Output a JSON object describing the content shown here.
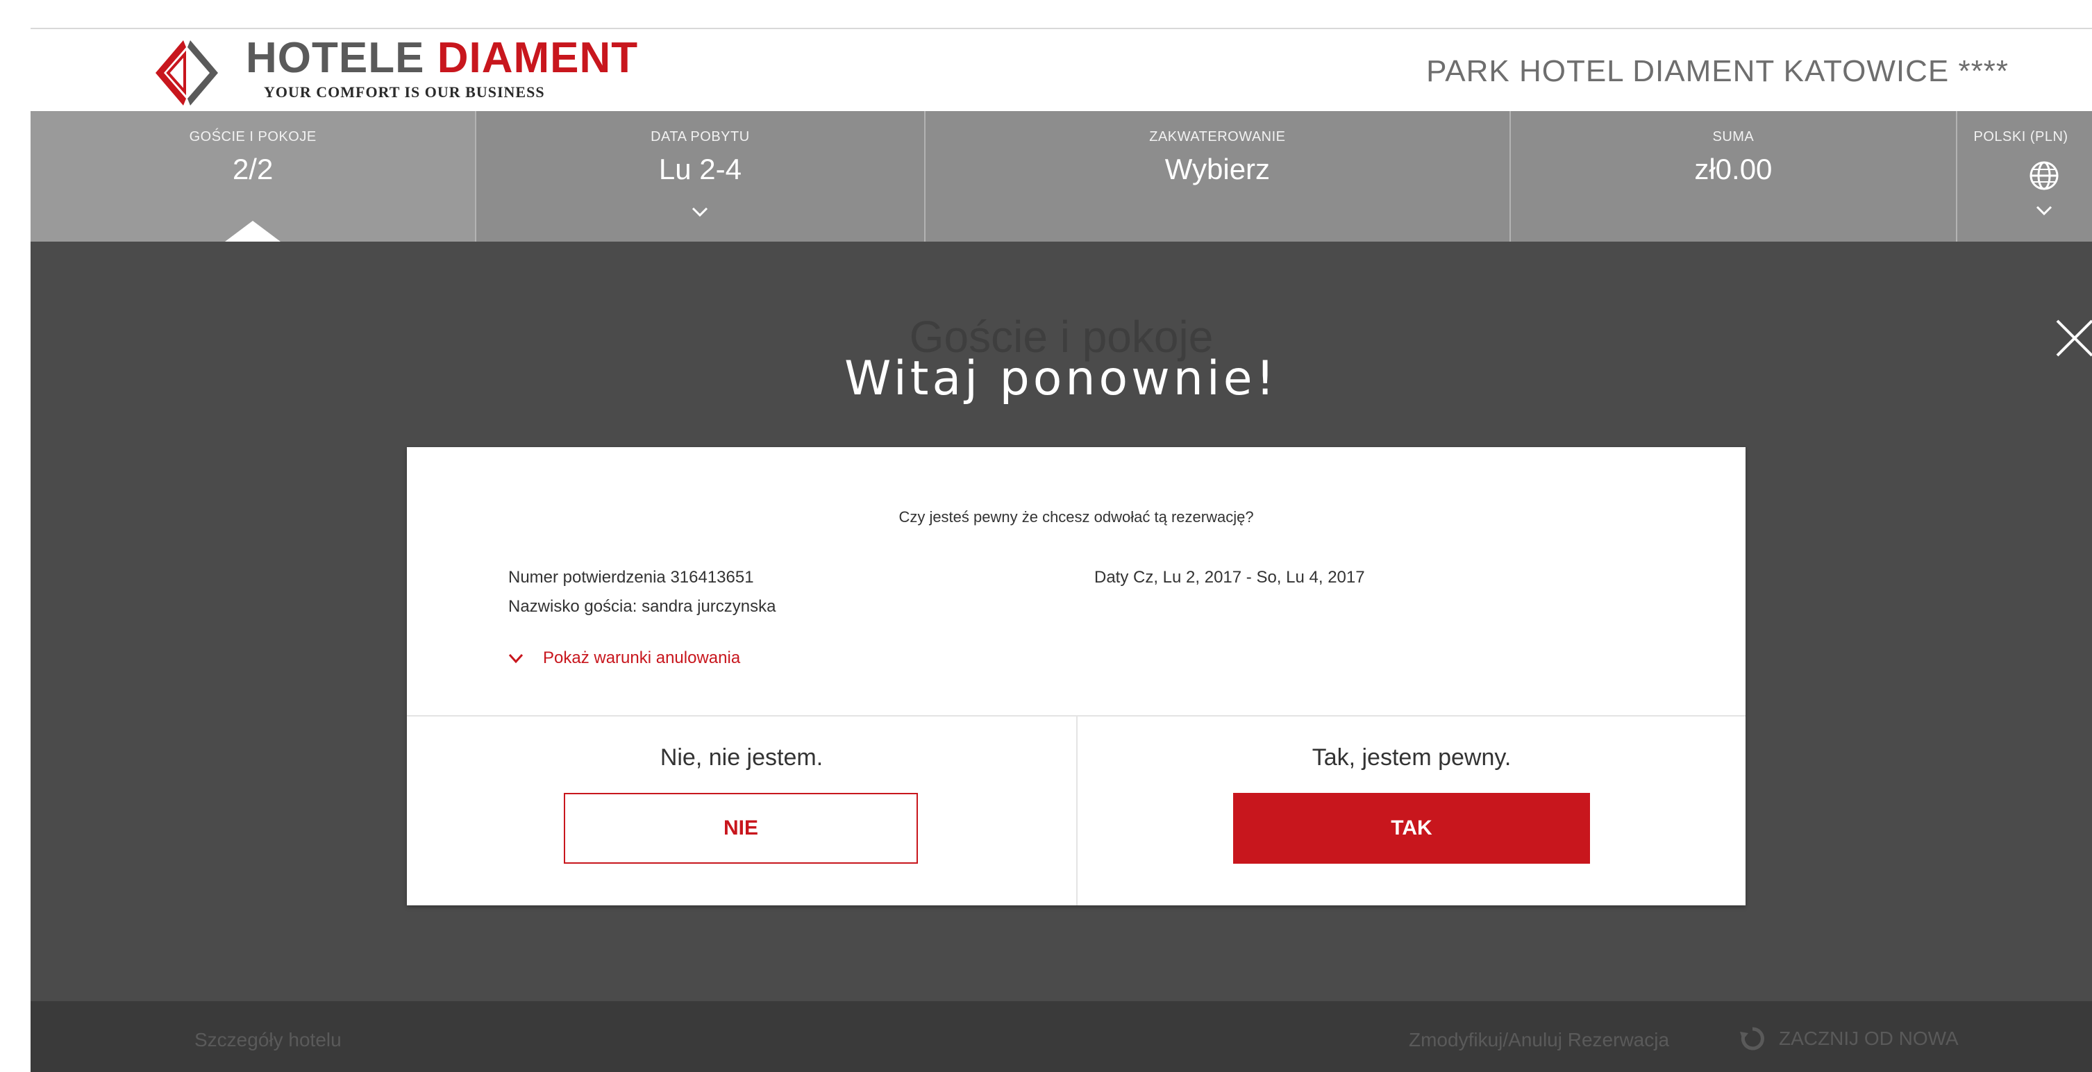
{
  "header": {
    "brand_word1": "HOTELE",
    "brand_word2": "DIAMENT",
    "tagline": "YOUR COMFORT IS OUR BUSINESS",
    "hotel_name": "PARK HOTEL DIAMENT KATOWICE ****"
  },
  "nav": {
    "guests": {
      "label": "GOŚCIE I POKOJE",
      "value": "2/2"
    },
    "dates": {
      "label": "DATA POBYTU",
      "value": "Lu 2-4"
    },
    "accommodation": {
      "label": "ZAKWATEROWANIE",
      "value": "Wybierz"
    },
    "total": {
      "label": "SUMA",
      "value": "zł0.00"
    },
    "language": {
      "label": "POLSKI (PLN)"
    }
  },
  "overlay": {
    "section_title": "Goście i pokoje",
    "welcome": "Witaj ponownie!"
  },
  "dialog": {
    "question": "Czy jesteś pewny że chcesz odwołać tą rezerwację?",
    "confirmation": "Numer potwierdzenia 316413651",
    "guest_name": "Nazwisko gościa: sandra jurczynska",
    "dates": "Daty Cz, Lu 2, 2017 - So, Lu 4, 2017",
    "terms_link": "Pokaż warunki anulowania",
    "no_prompt": "Nie, nie jestem.",
    "no_button": "NIE",
    "yes_prompt": "Tak, jestem pewny.",
    "yes_button": "TAK"
  },
  "footer": {
    "hotel_details": "Szczegóły hotelu",
    "modify_cancel": "Zmodyfikuj/Anuluj Rezerwacja",
    "restart": "ZACZNIJ OD NOWA"
  },
  "colors": {
    "brand_red": "#c8161d",
    "nav_gray": "#8d8d8d",
    "overlay_dark": "#4b4b4b"
  },
  "icons": [
    "diamond-logo-icon",
    "chevron-down-icon",
    "globe-icon",
    "close-icon",
    "restart-icon"
  ]
}
